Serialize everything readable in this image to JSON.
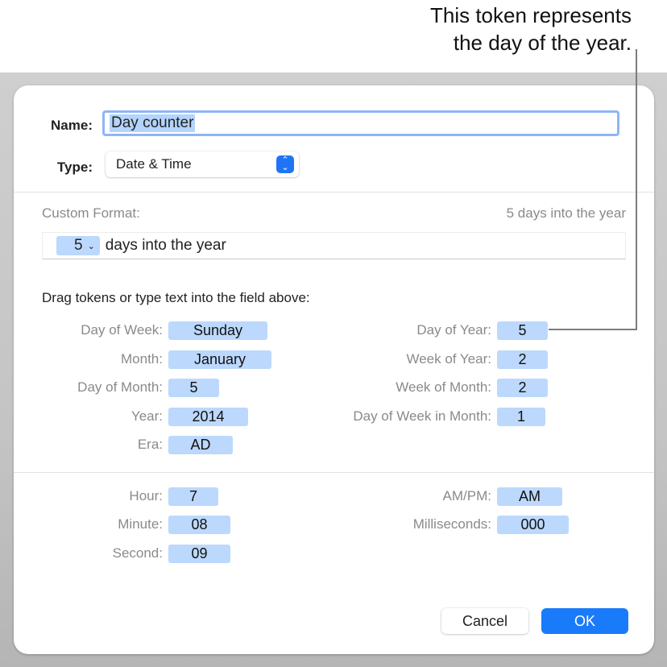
{
  "callout": {
    "line1": "This token represents",
    "line2": "the day of the year."
  },
  "dialog": {
    "name_label": "Name:",
    "name_value": "Day counter",
    "type_label": "Type:",
    "type_value": "Date & Time",
    "custom_format_label": "Custom Format:",
    "format_preview": "5 days into the year",
    "format_field": {
      "token_value": "5",
      "text": "days into the year"
    },
    "instructions": "Drag tokens or type text into the field above:",
    "date_tokens_left": [
      {
        "label": "Day of Week:",
        "value": "Sunday"
      },
      {
        "label": "Month:",
        "value": "January"
      },
      {
        "label": "Day of Month:",
        "value": "5"
      },
      {
        "label": "Year:",
        "value": "2014"
      },
      {
        "label": "Era:",
        "value": "AD"
      }
    ],
    "date_tokens_right": [
      {
        "label": "Day of Year:",
        "value": "5"
      },
      {
        "label": "Week of Year:",
        "value": "2"
      },
      {
        "label": "Week of Month:",
        "value": "2"
      },
      {
        "label": "Day of Week in Month:",
        "value": "1"
      }
    ],
    "time_tokens_left": [
      {
        "label": "Hour:",
        "value": "7"
      },
      {
        "label": "Minute:",
        "value": "08"
      },
      {
        "label": "Second:",
        "value": "09"
      }
    ],
    "time_tokens_right": [
      {
        "label": "AM/PM:",
        "value": "AM"
      },
      {
        "label": "Milliseconds:",
        "value": "000"
      }
    ],
    "cancel_label": "Cancel",
    "ok_label": "OK"
  },
  "colors": {
    "accent": "#1a7bfa",
    "token_bg": "#bcd8fc",
    "focus_ring": "#8fb5f7"
  }
}
